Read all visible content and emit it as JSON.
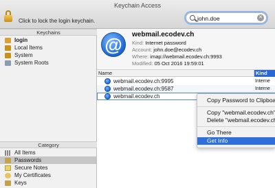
{
  "window": {
    "title": "Keychain Access"
  },
  "toolbar": {
    "lock_label": "Click to lock the login keychain.",
    "search_value": "john.doe",
    "clear_symbol": "✕"
  },
  "keychains": {
    "header": "Keychains",
    "items": [
      {
        "label": "login",
        "icon": "lock-icon",
        "bold": true
      },
      {
        "label": "Local Items",
        "icon": "lock-icon"
      },
      {
        "label": "System",
        "icon": "lock-icon"
      },
      {
        "label": "System Roots",
        "icon": "folder-icon"
      }
    ]
  },
  "category": {
    "header": "Category",
    "items": [
      {
        "label": "All Items",
        "icon": "all-items-icon"
      },
      {
        "label": "Passwords",
        "icon": "key-icon",
        "selected": true
      },
      {
        "label": "Secure Notes",
        "icon": "note-icon"
      },
      {
        "label": "My Certificates",
        "icon": "certificate-icon"
      },
      {
        "label": "Keys",
        "icon": "key-icon"
      }
    ]
  },
  "detail": {
    "title": "webmail.ecodev.ch",
    "kind_label": "Kind:",
    "kind_value": "Internet password",
    "account_label": "Account:",
    "account_value": "john.doe@ecodev.ch",
    "where_label": "Where:",
    "where_value": "imap://webmail.ecodev.ch:9993",
    "modified_label": "Modified:",
    "modified_value": "05 Oct 2016 19:59:01"
  },
  "table": {
    "columns": {
      "name": "Name",
      "kind": "Kind"
    },
    "rows": [
      {
        "name": "webmail.ecodev.ch:9995",
        "kind": "Interne"
      },
      {
        "name": "webmail.ecodev.ch:9587",
        "kind": "Interne"
      },
      {
        "name": "webmail.ecodev.ch",
        "kind": "",
        "selected": true
      }
    ]
  },
  "context_menu": {
    "copy_password": "Copy Password to Clipboa",
    "copy_item": "Copy \"webmail.ecodev.ch\"",
    "delete_item": "Delete \"webmail.ecodev.ch\"",
    "go_there": "Go There",
    "get_info": "Get Info",
    "highlighted": "Get Info"
  },
  "colors": {
    "selection_blue": "#2f6fdc",
    "header_blue": "#2a67d6"
  }
}
